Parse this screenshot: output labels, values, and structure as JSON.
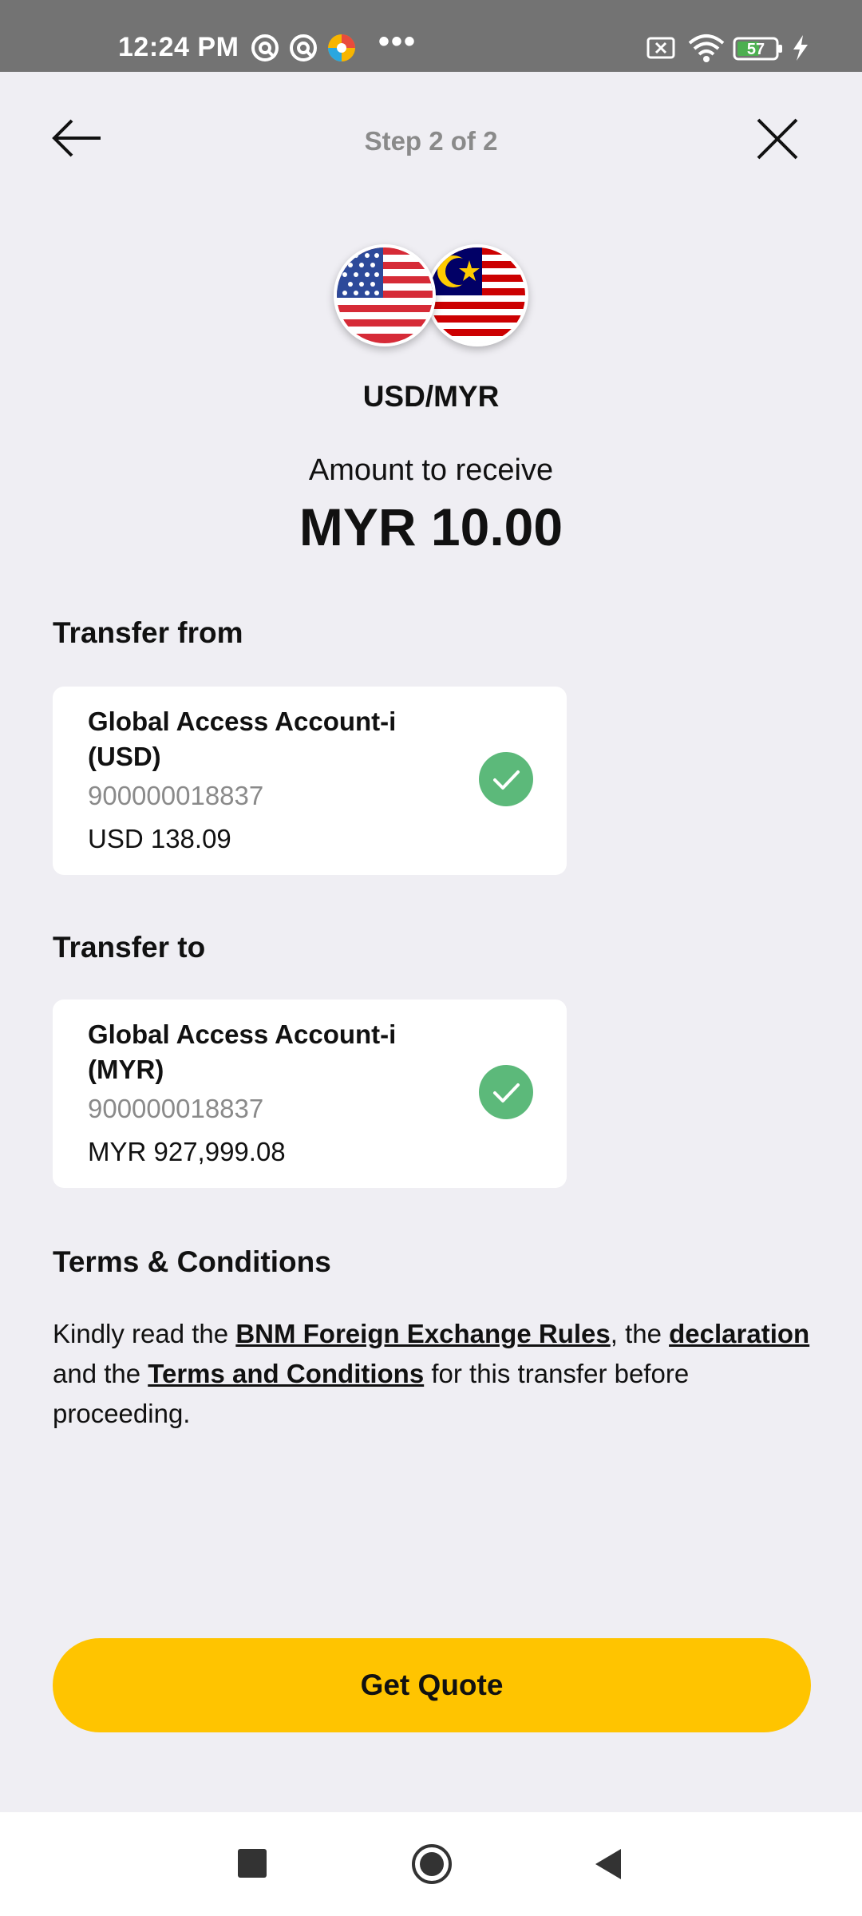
{
  "status_bar": {
    "time": "12:24 PM",
    "more_dots": "•••",
    "battery_level": "57"
  },
  "header": {
    "step_label": "Step 2 of 2"
  },
  "currency": {
    "pair": "USD/MYR",
    "receive_label": "Amount to receive",
    "receive_amount": "MYR 10.00"
  },
  "transfer_from": {
    "title": "Transfer from",
    "account_name": "Global Access Account-i (USD)",
    "account_number": "900000018837",
    "balance": "USD 138.09",
    "selected": true
  },
  "transfer_to": {
    "title": "Transfer to",
    "account_name": "Global Access Account-i (MYR)",
    "account_number": "900000018837",
    "balance": "MYR 927,999.08",
    "selected": true
  },
  "terms": {
    "title": "Terms & Conditions",
    "text_1": "Kindly read the ",
    "link_rules": "BNM Foreign Exchange Rules",
    "text_2": ", the ",
    "link_declaration": "declaration",
    "text_3": " and the ",
    "link_terms": "Terms and Conditions",
    "text_4": " for this transfer before proceeding."
  },
  "actions": {
    "get_quote_label": "Get Quote"
  },
  "colors": {
    "accent_yellow": "#ffc400",
    "check_green": "#5cb97a",
    "background": "#efeef3"
  }
}
